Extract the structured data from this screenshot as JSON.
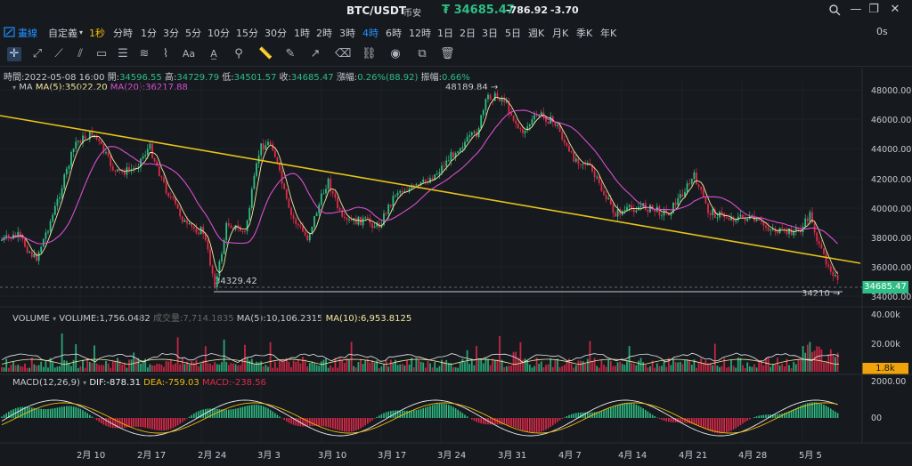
{
  "header": {
    "symbol": "BTC/USDT",
    "exchange": "币安",
    "price": "₮ 34685.47",
    "change": "-786.92",
    "change_pct": "-3.70",
    "window_buttons": [
      "search-icon",
      "maximize-icon",
      "restore-icon",
      "close-icon"
    ]
  },
  "timeframes": {
    "items": [
      {
        "label": "畫線",
        "icon": "drawing-icon"
      },
      {
        "label": "自定義",
        "icon": "chevron-down-icon"
      },
      {
        "label": "1秒"
      },
      {
        "label": "分時"
      },
      {
        "label": "1分"
      },
      {
        "label": "3分"
      },
      {
        "label": "5分"
      },
      {
        "label": "10分"
      },
      {
        "label": "15分"
      },
      {
        "label": "30分"
      },
      {
        "label": "1時"
      },
      {
        "label": "2時"
      },
      {
        "label": "3時"
      },
      {
        "label": "4時",
        "active": true
      },
      {
        "label": "6時"
      },
      {
        "label": "12時"
      },
      {
        "label": "1日"
      },
      {
        "label": "2日"
      },
      {
        "label": "3日"
      },
      {
        "label": "5日"
      },
      {
        "label": "週K"
      },
      {
        "label": "月K"
      },
      {
        "label": "季K"
      },
      {
        "label": "年K"
      }
    ],
    "interval_right": "0s"
  },
  "toolbar": {
    "icons": [
      "crosshair-icon",
      "cursor-icon",
      "trendline-icon",
      "parallel-channel-icon",
      "rectangle-icon",
      "horizontal-lines-icon",
      "fib-icon",
      "brush-icon",
      "text-icon",
      "text-box-icon",
      "measure-icon",
      "ruler-icon",
      "pencil-icon",
      "arrow-icon",
      "eraser-icon",
      "lock-icon",
      "trash-icon"
    ]
  },
  "ohlc": {
    "time_label": "時間:",
    "time": "2022-05-08 16:00",
    "open_label": "開:",
    "open": "34596.55",
    "high_label": "高:",
    "high": "34729.79",
    "low_label": "低:",
    "low": "34501.57",
    "close_label": "收:",
    "close": "34685.47",
    "chg_label": "漲幅:",
    "chg": "0.26%(88.92)",
    "amp_label": "振幅:",
    "amp": "0.66%"
  },
  "ma": {
    "name": "MA",
    "ma5": "MA(5):35022.20",
    "ma20": "MA(20):36217.88"
  },
  "volume": {
    "name": "VOLUME",
    "value": "VOLUME:1,756.0482",
    "quote": "成交量:7,714.1835",
    "ma5": "MA(5):10,106.2315",
    "ma10": "MA(10):6,953.8125",
    "tag": "1.8k",
    "axis": [
      "40.00k",
      "20.00k"
    ]
  },
  "macd": {
    "name": "MACD(12,26,9)",
    "dif": "DIF:-878.31",
    "dea": "DEA:-759.03",
    "macd": "MACD:-238.56",
    "axis": [
      "2000.00",
      "00"
    ]
  },
  "price_axis": [
    "48000.00",
    "46000.00",
    "44000.00",
    "42000.00",
    "40000.00",
    "38000.00",
    "36000.00",
    "34000.00"
  ],
  "price_tag": "34685.47",
  "annotations": {
    "high": "48189.84",
    "low_left": "34329.42",
    "low_right": "34210"
  },
  "x_axis": [
    "2月 10",
    "2月 17",
    "2月 24",
    "3月 3",
    "3月 10",
    "3月 17",
    "3月 24",
    "3月 31",
    "4月 7",
    "4月 14",
    "4月 21",
    "4月 28",
    "5月 5"
  ],
  "colors": {
    "up": "#2ebd85",
    "down": "#e0294a",
    "ma5": "#f5e79e",
    "ma20": "#d84fd0",
    "trend": "#e8c21a",
    "accent": "#1e90ff"
  }
}
